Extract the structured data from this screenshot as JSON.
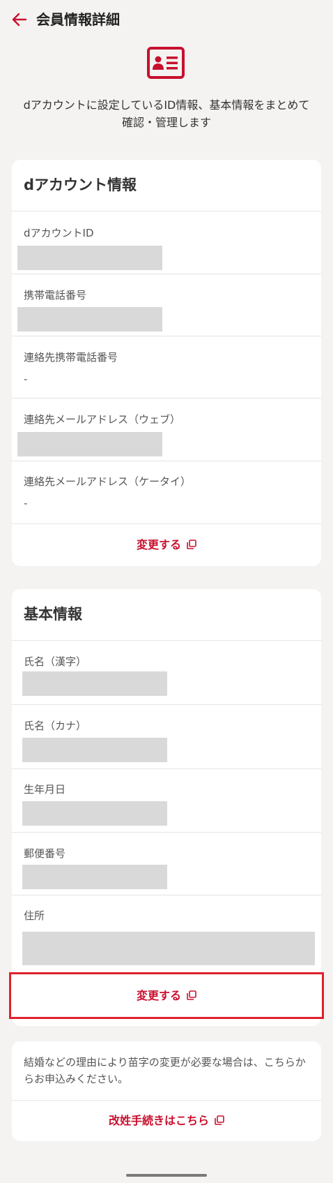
{
  "header": {
    "title": "会員情報詳細"
  },
  "intro": {
    "text": "dアカウントに設定しているID情報、基本情報をまとめて確認・管理します"
  },
  "colors": {
    "accent": "#c8102e",
    "highlight_border": "#e0202d",
    "page_background": "#f4f3f1",
    "masked_value": "#d9d9d9"
  },
  "icons": {
    "back": "arrow-left-icon",
    "member_card": "id-card-icon",
    "external": "external-window-icon"
  },
  "daccount": {
    "title": "dアカウント情報",
    "fields": [
      {
        "label": "dアカウントID",
        "value": ""
      },
      {
        "label": "携帯電話番号",
        "value": ""
      },
      {
        "label": "連絡先携帯電話番号",
        "value": "-"
      },
      {
        "label": "連絡先メールアドレス（ウェブ）",
        "value": ""
      },
      {
        "label": "連絡先メールアドレス（ケータイ）",
        "value": "-"
      }
    ],
    "change_label": "変更する"
  },
  "basic": {
    "title": "基本情報",
    "fields": [
      {
        "label": "氏名（漢字）",
        "value": ""
      },
      {
        "label": "氏名（カナ）",
        "value": ""
      },
      {
        "label": "生年月日",
        "value": ""
      },
      {
        "label": "郵便番号",
        "value": ""
      },
      {
        "label": "住所",
        "value": ""
      }
    ],
    "change_label": "変更する"
  },
  "surname": {
    "note": "結婚などの理由により苗字の変更が必要な場合は、こちらからお申込みください。",
    "link_label": "改姓手続きはこちら"
  }
}
